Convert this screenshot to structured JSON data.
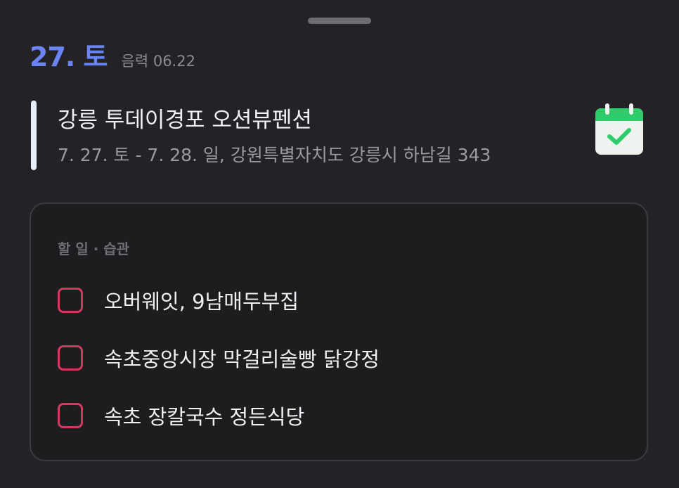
{
  "header": {
    "date": "27. 토",
    "lunar_date": "음력 06.22"
  },
  "event": {
    "title": "강릉 투데이경포 오션뷰펜션",
    "detail": "7. 27. 토 - 7. 28. 일, 강원특별자치도 강릉시 하남길 343",
    "bar_color": "#e8ecfb",
    "icon": "calendar-check-icon",
    "icon_color": "#2ecc6a"
  },
  "tasks": {
    "section_label": "할 일 · 습관",
    "checkbox_color": "#d1395f",
    "items": [
      {
        "label": "오버웨잇, 9남매두부집",
        "checked": false
      },
      {
        "label": "속초중앙시장 막걸리술빵 닭강정",
        "checked": false
      },
      {
        "label": "속초 장칼국수 정든식당",
        "checked": false
      }
    ]
  },
  "theme": {
    "accent": "#6a84f5",
    "background": "#232327"
  }
}
